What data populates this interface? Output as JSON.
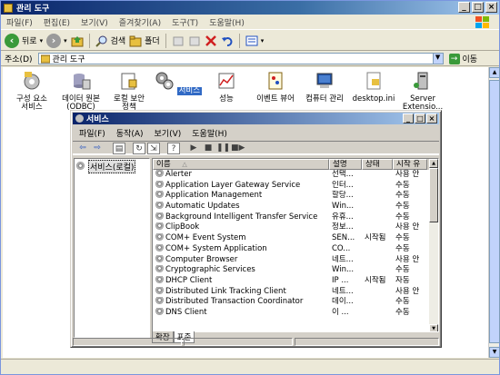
{
  "window": {
    "title": "관리 도구"
  },
  "menu": [
    "파일(F)",
    "편집(E)",
    "보기(V)",
    "즐겨찾기(A)",
    "도구(T)",
    "도움말(H)"
  ],
  "toolbar": {
    "back": "뒤로",
    "search": "검색",
    "folders": "폴더"
  },
  "address": {
    "label": "주소(D)",
    "value": "관리 도구",
    "go": "이동"
  },
  "icons": [
    {
      "label": "구성 요소\n서비스",
      "icon": "component-services-icon"
    },
    {
      "label": "데이터 원본\n(ODBC)",
      "icon": "odbc-icon"
    },
    {
      "label": "로컬 보안\n정책",
      "icon": "security-policy-icon"
    },
    {
      "label": "서비스",
      "icon": "services-icon"
    },
    {
      "label": "성능",
      "icon": "performance-icon"
    },
    {
      "label": "이벤트 뷰어",
      "icon": "event-viewer-icon"
    },
    {
      "label": "컴퓨터 관리",
      "icon": "computer-management-icon"
    },
    {
      "label": "desktop.ini",
      "icon": "ini-file-icon"
    },
    {
      "label": "Server\nExtensio...",
      "icon": "server-extensions-icon"
    }
  ],
  "services_window": {
    "title": "서비스",
    "menu": [
      "파일(F)",
      "동작(A)",
      "보기(V)",
      "도움말(H)"
    ],
    "tree_root": "서비스(로컬)",
    "columns": [
      "이름",
      "설명",
      "상태",
      "시작 유"
    ],
    "rows": [
      [
        "Alerter",
        "선택...",
        "",
        "사용 안"
      ],
      [
        "Application Layer Gateway Service",
        "인터...",
        "",
        "수동"
      ],
      [
        "Application Management",
        "할당...",
        "",
        "수동"
      ],
      [
        "Automatic Updates",
        "Win...",
        "",
        "수동"
      ],
      [
        "Background Intelligent Transfer Service",
        "유휴...",
        "",
        "수동"
      ],
      [
        "ClipBook",
        "정보...",
        "",
        "사용 안"
      ],
      [
        "COM+ Event System",
        "SEN...",
        "시작됨",
        "수동"
      ],
      [
        "COM+ System Application",
        "CO...",
        "",
        "수동"
      ],
      [
        "Computer Browser",
        "네트...",
        "",
        "사용 안"
      ],
      [
        "Cryptographic Services",
        "Win...",
        "",
        "수동"
      ],
      [
        "DHCP Client",
        "IP ...",
        "시작됨",
        "자동"
      ],
      [
        "Distributed Link Tracking Client",
        "네트...",
        "",
        "사용 안"
      ],
      [
        "Distributed Transaction Coordinator",
        "데이...",
        "",
        "수동"
      ],
      [
        "DNS Client",
        "이 ...",
        "",
        "수동"
      ]
    ],
    "tabs": [
      "확장",
      "표준"
    ]
  }
}
